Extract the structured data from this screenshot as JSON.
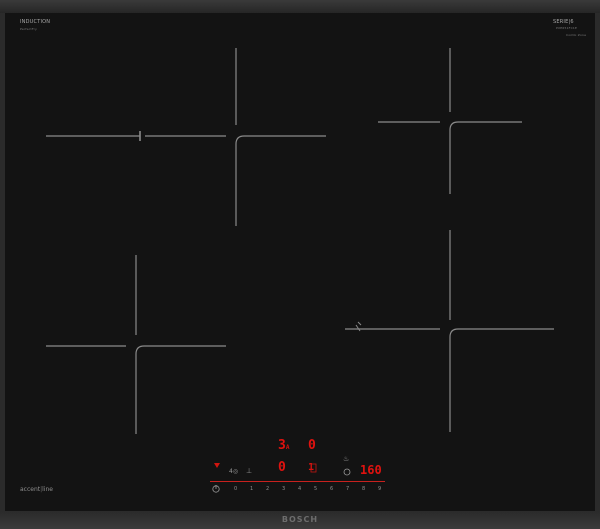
{
  "labels": {
    "induction": "INDUCTION",
    "induction_sub": "PerfectFry",
    "series": "SERIE|6",
    "series_sub": "PXE651FC1E",
    "series_note": "Combi Zone",
    "accent": "accent",
    "accent_line": "line"
  },
  "display": {
    "left_top": "3",
    "left_top_suffix": "A",
    "left_bottom": "0",
    "mid_top": "0",
    "mid_bottom": "1",
    "right": "160",
    "timer_icon": "timer-icon",
    "power_icon": "power-icon"
  },
  "slider": [
    "0",
    "1",
    "2",
    "3",
    "4",
    "5",
    "6",
    "7",
    "8",
    "9"
  ],
  "brand": "BOSCH",
  "colors": {
    "glass": "#131313",
    "frame": "#2b2b2b",
    "display": "#e0120f",
    "markings": "#8a8a8a"
  }
}
